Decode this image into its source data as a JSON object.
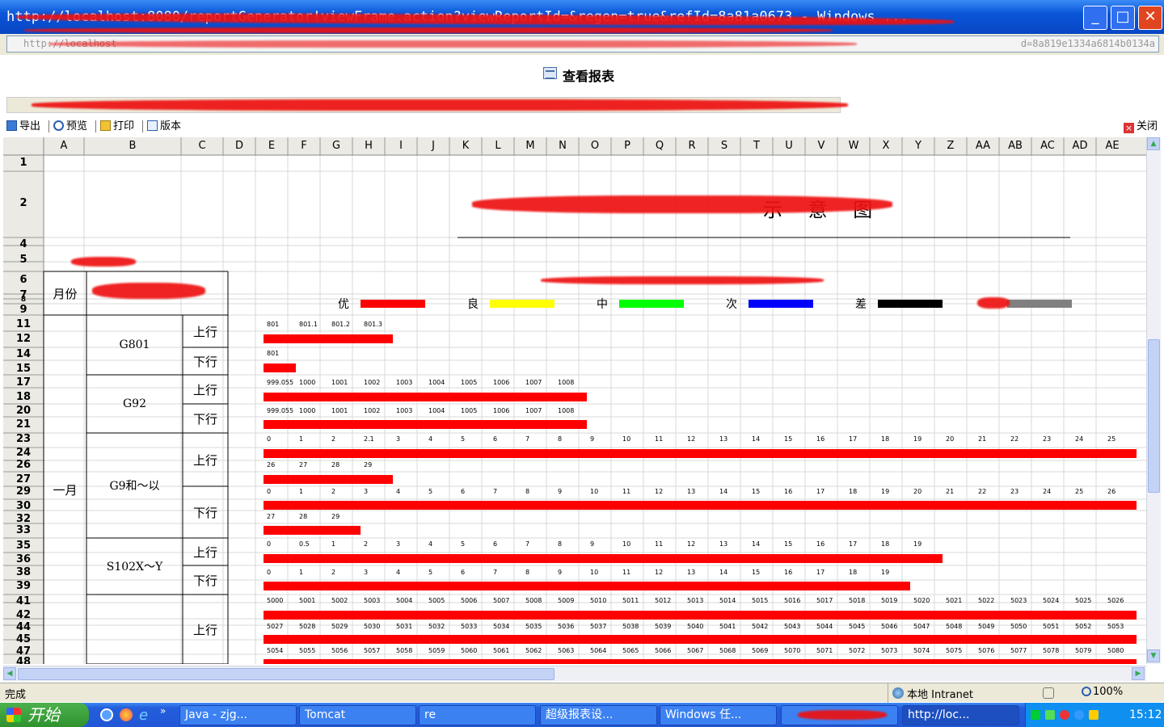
{
  "window": {
    "title": "http://localhost:8080/reportGenerator!viewFrame.action?viewReportId=&regen=true&refId=8a81a0673 - Windows ...",
    "url_visible": "http://localhost",
    "url_tail": "d=8a819e1334a6814b0134a",
    "minimize_label": "_",
    "maximize_label": "□",
    "close_label": "✕"
  },
  "page": {
    "heading": "查看报表"
  },
  "toolbar": {
    "export_label": "导出",
    "preview_label": "预览",
    "print_label": "打印",
    "version_label": "版本",
    "close_label": "关闭"
  },
  "sheet": {
    "columns": [
      "A",
      "B",
      "C",
      "D",
      "E",
      "F",
      "G",
      "H",
      "I",
      "J",
      "K",
      "L",
      "M",
      "N",
      "O",
      "P",
      "Q",
      "R",
      "S",
      "T",
      "U",
      "V",
      "W",
      "X",
      "Y",
      "Z",
      "AA",
      "AB",
      "AC",
      "AD",
      "AE"
    ],
    "row_labels": [
      {
        "label": "1"
      },
      {
        "label": "2"
      },
      {
        "label": "4"
      },
      {
        "label": "5"
      },
      {
        "label": "6"
      },
      {
        "label": "7"
      },
      {
        "label": "8"
      },
      {
        "label": "9"
      },
      {
        "label": "11"
      },
      {
        "label": "12"
      },
      {
        "label": "14"
      },
      {
        "label": "15"
      },
      {
        "label": "17"
      },
      {
        "label": "18"
      },
      {
        "label": "20"
      },
      {
        "label": "21"
      },
      {
        "label": "23"
      },
      {
        "label": "24"
      },
      {
        "label": "26"
      },
      {
        "label": "27"
      },
      {
        "label": "29"
      },
      {
        "label": "30"
      },
      {
        "label": "32"
      },
      {
        "label": "33"
      },
      {
        "label": "35"
      },
      {
        "label": "36"
      },
      {
        "label": "38"
      },
      {
        "label": "39"
      },
      {
        "label": "41"
      },
      {
        "label": "42"
      },
      {
        "label": "44"
      },
      {
        "label": "45"
      },
      {
        "label": "47"
      },
      {
        "label": "48"
      }
    ],
    "chart_title_tail": "示 意 图",
    "month_header": "月份",
    "month_value": "一月",
    "legend": [
      {
        "label": "优",
        "color": "#ff0000"
      },
      {
        "label": "良",
        "color": "#ffff00"
      },
      {
        "label": "中",
        "color": "#00ff00"
      },
      {
        "label": "次",
        "color": "#0000ff"
      },
      {
        "label": "差",
        "color": "#000000"
      },
      {
        "label": "",
        "color": "#808080"
      }
    ],
    "roads": [
      {
        "name": "G801",
        "directions": [
          "上行",
          "下行"
        ]
      },
      {
        "name": "G92",
        "directions": [
          "上行",
          "下行"
        ]
      },
      {
        "name": "G9和～以",
        "directions": [
          "上行",
          "下行"
        ]
      },
      {
        "name": "S102X～Y",
        "directions": [
          "上行",
          "下行"
        ]
      },
      {
        "name": "",
        "directions": [
          "上行"
        ]
      }
    ],
    "tracks": [
      {
        "labels": [
          "801",
          "801.1",
          "801.2",
          "801.3"
        ]
      },
      {
        "labels": [
          "801"
        ]
      },
      {
        "labels": [
          "999.055",
          "1000",
          "1001",
          "1002",
          "1003",
          "1004",
          "1005",
          "1006",
          "1007",
          "1008"
        ]
      },
      {
        "labels": [
          "999.055",
          "1000",
          "1001",
          "1002",
          "1003",
          "1004",
          "1005",
          "1006",
          "1007",
          "1008"
        ]
      },
      {
        "labels": [
          "0",
          "1",
          "2",
          "2.1",
          "3",
          "4",
          "5",
          "6",
          "7",
          "8",
          "9",
          "10",
          "11",
          "12",
          "13",
          "14",
          "15",
          "16",
          "17",
          "18",
          "19",
          "20",
          "21",
          "22",
          "23",
          "24",
          "25"
        ]
      },
      {
        "labels": [
          "26",
          "27",
          "28",
          "29"
        ]
      },
      {
        "labels": [
          "0",
          "1",
          "2",
          "3",
          "4",
          "5",
          "6",
          "7",
          "8",
          "9",
          "10",
          "11",
          "12",
          "13",
          "14",
          "15",
          "16",
          "17",
          "18",
          "19",
          "20",
          "21",
          "22",
          "23",
          "24",
          "25",
          "26"
        ]
      },
      {
        "labels": [
          "27",
          "28",
          "29"
        ]
      },
      {
        "labels": [
          "0",
          "0.5",
          "1",
          "2",
          "3",
          "4",
          "5",
          "6",
          "7",
          "8",
          "9",
          "10",
          "11",
          "12",
          "13",
          "14",
          "15",
          "16",
          "17",
          "18",
          "19"
        ]
      },
      {
        "labels": [
          "0",
          "1",
          "2",
          "3",
          "4",
          "5",
          "6",
          "7",
          "8",
          "9",
          "10",
          "11",
          "12",
          "13",
          "14",
          "15",
          "16",
          "17",
          "18",
          "19"
        ]
      },
      {
        "labels": [
          "5000",
          "5001",
          "5002",
          "5003",
          "5004",
          "5005",
          "5006",
          "5007",
          "5008",
          "5009",
          "5010",
          "5011",
          "5012",
          "5013",
          "5014",
          "5015",
          "5016",
          "5017",
          "5018",
          "5019",
          "5020",
          "5021",
          "5022",
          "5023",
          "5024",
          "5025",
          "5026"
        ]
      },
      {
        "labels": [
          "5027",
          "5028",
          "5029",
          "5030",
          "5031",
          "5032",
          "5033",
          "5034",
          "5035",
          "5036",
          "5037",
          "5038",
          "5039",
          "5040",
          "5041",
          "5042",
          "5043",
          "5044",
          "5045",
          "5046",
          "5047",
          "5048",
          "5049",
          "5050",
          "5051",
          "5052",
          "5053"
        ]
      },
      {
        "labels": [
          "5054",
          "5055",
          "5056",
          "5057",
          "5058",
          "5059",
          "5060",
          "5061",
          "5062",
          "5063",
          "5064",
          "5065",
          "5066",
          "5067",
          "5068",
          "5069",
          "5070",
          "5071",
          "5072",
          "5073",
          "5074",
          "5075",
          "5076",
          "5077",
          "5078",
          "5079",
          "5080"
        ]
      }
    ]
  },
  "status": {
    "text": "完成",
    "zone": "本地 Intranet",
    "zoom": "100%"
  },
  "taskbar": {
    "start_label": "开始",
    "tasks": [
      {
        "label": "Java - zjg..."
      },
      {
        "label": "Tomcat"
      },
      {
        "label": "re"
      },
      {
        "label": "超级报表设..."
      },
      {
        "label": "Windows 任..."
      },
      {
        "label": ""
      },
      {
        "label": "http://loc..."
      }
    ],
    "clock": "15:12"
  }
}
